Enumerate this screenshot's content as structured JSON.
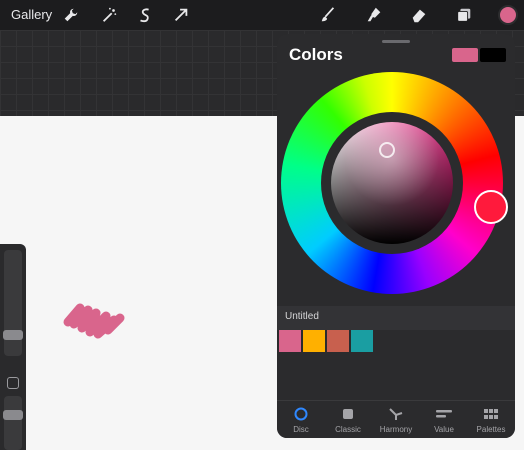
{
  "toolbar": {
    "gallery_label": "Gallery",
    "icons": [
      "wrench-icon",
      "magic-wand-icon",
      "selection-icon",
      "transform-arrow-icon",
      "brush-icon",
      "smudge-icon",
      "eraser-icon",
      "layers-icon"
    ],
    "current_color": "#d9658c"
  },
  "colors_panel": {
    "title": "Colors",
    "primary_color": "#d9658c",
    "secondary_color": "#000000",
    "hue_marker_color": "#ff1a3c",
    "palette": {
      "name": "Untitled",
      "swatches": [
        "#d9658c",
        "#ffb000",
        "#c8604e",
        "#1a9ea2"
      ]
    },
    "tabs": [
      {
        "label": "Disc",
        "icon": "disc-icon",
        "active": true
      },
      {
        "label": "Classic",
        "icon": "square-icon",
        "active": false
      },
      {
        "label": "Harmony",
        "icon": "harmony-icon",
        "active": false
      },
      {
        "label": "Value",
        "icon": "value-bars-icon",
        "active": false
      },
      {
        "label": "Palettes",
        "icon": "grid-icon",
        "active": false
      }
    ]
  },
  "stroke_color": "#d9658c"
}
